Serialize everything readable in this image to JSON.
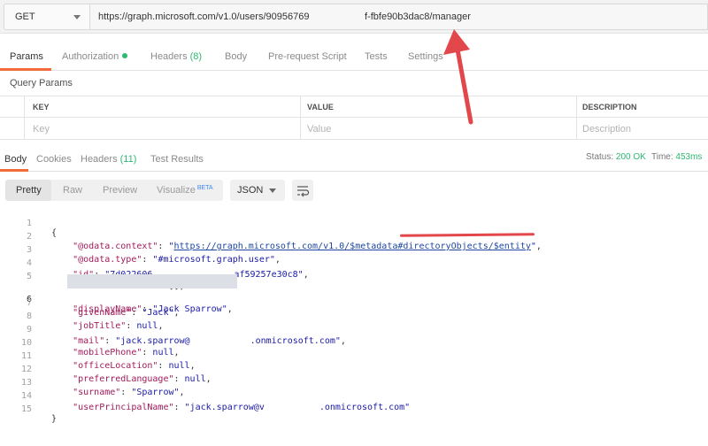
{
  "request": {
    "method": "GET",
    "url_start": "https://graph.microsoft.com/v1.0/users/90956769",
    "url_end": "f-fbfe90b3dac8/manager"
  },
  "request_tabs": [
    {
      "label": "Params"
    },
    {
      "label": "Authorization"
    },
    {
      "label": "Headers",
      "count": "(8)"
    },
    {
      "label": "Body"
    },
    {
      "label": "Pre-request Script"
    },
    {
      "label": "Tests"
    },
    {
      "label": "Settings"
    }
  ],
  "query_params": {
    "title": "Query Params",
    "columns": [
      "KEY",
      "VALUE",
      "DESCRIPTION"
    ],
    "placeholders": [
      "Key",
      "Value",
      "Description"
    ]
  },
  "response_tabs": [
    {
      "label": "Body"
    },
    {
      "label": "Cookies"
    },
    {
      "label": "Headers",
      "count": "(11)"
    },
    {
      "label": "Test Results"
    }
  ],
  "status": {
    "status_label": "Status:",
    "status_value": "200 OK",
    "time_label": "Time:",
    "time_value": "453ms"
  },
  "view": {
    "modes": [
      "Pretty",
      "Raw",
      "Preview",
      "Visualize"
    ],
    "beta": "BETA",
    "format": "JSON"
  },
  "code": {
    "line_numbers": [
      "1",
      "2",
      "3",
      "4",
      "5",
      "6",
      "7",
      "8",
      "9",
      "10",
      "11",
      "12",
      "13",
      "14",
      "15"
    ],
    "open_brace": "{",
    "close_brace": "}",
    "odata_context_key": "\"@odata.context\"",
    "odata_context_url": "https://graph.microsoft.com/v1.0/$metadata#directoryObjects/$entity",
    "odata_type_key": "\"@odata.type\"",
    "odata_type_val": "\"#microsoft.graph.user\"",
    "id_key": "\"id\"",
    "id_val_start": "\"7d022606",
    "id_val_end": "af59257e30c8\"",
    "businessPhones_key": "\"businessPhones\"",
    "businessPhones_val": "[]",
    "displayName_key": "\"displayName\"",
    "displayName_val": "\"Jack Sparrow\"",
    "givenName_key": "\"givenName\"",
    "givenName_val": "\"Jack\"",
    "jobTitle_key": "\"jobTitle\"",
    "mail_key": "\"mail\"",
    "mail_val_start": "\"jack.sparrow@",
    "mail_val_end": ".onmicrosoft.com\"",
    "mobilePhone_key": "\"mobilePhone\"",
    "officeLocation_key": "\"officeLocation\"",
    "preferredLanguage_key": "\"preferredLanguage\"",
    "surname_key": "\"surname\"",
    "surname_val": "\"Sparrow\"",
    "upn_key": "\"userPrincipalName\"",
    "upn_val_start": "\"jack.sparrow@v",
    "upn_val_end": ".onmicrosoft.com\"",
    "null_val": "null"
  },
  "colors": {
    "accent": "#f26b3a",
    "success": "#2eb872",
    "annotation": "#e2474b"
  }
}
